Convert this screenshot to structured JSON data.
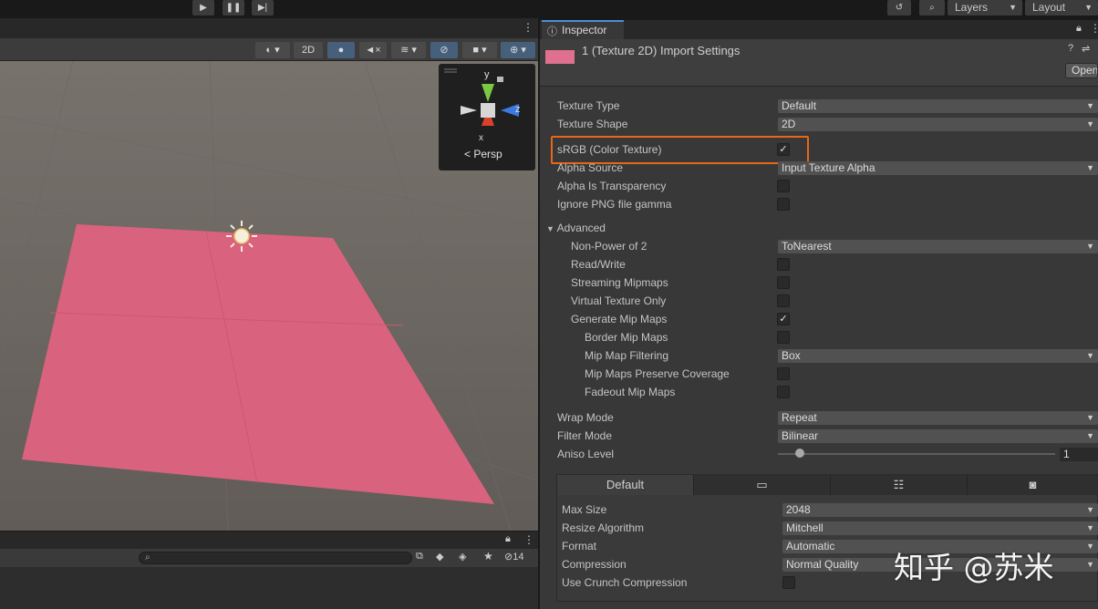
{
  "top_toolbar": {
    "play_icon": "play-icon",
    "pause_icon": "pause-icon",
    "step_icon": "step-icon",
    "history_icon": "history-icon",
    "search_icon": "search-icon",
    "layers_label": "Layers",
    "layout_label": "Layout"
  },
  "scene_toolbar": {
    "mode_2d": "2D",
    "gizmo_view": "< Persp",
    "axis_y": "y",
    "axis_z": "z",
    "axis_x": "x"
  },
  "bottom_panel": {
    "search_placeholder": "",
    "hidden_count": "14"
  },
  "inspector": {
    "tab_label": "Inspector",
    "header_title": "1 (Texture 2D) Import Settings",
    "open_button": "Open",
    "swatch_color": "#e07090",
    "rows": [
      {
        "label": "Texture Type",
        "value": "Default"
      },
      {
        "label": "Texture Shape",
        "value": "2D"
      },
      {
        "label": "sRGB (Color Texture)",
        "value": "✓"
      },
      {
        "label": "Alpha Source",
        "value": "Input Texture Alpha"
      },
      {
        "label": "Alpha Is Transparency",
        "value": ""
      },
      {
        "label": "Ignore PNG file gamma",
        "value": ""
      }
    ],
    "advanced": {
      "label": "Advanced",
      "rows": [
        {
          "label": "Non-Power of 2",
          "value": "ToNearest"
        },
        {
          "label": "Read/Write",
          "value": ""
        },
        {
          "label": "Streaming Mipmaps",
          "value": ""
        },
        {
          "label": "Virtual Texture Only",
          "value": ""
        },
        {
          "label": "Generate Mip Maps",
          "value": "✓"
        },
        {
          "label": "Border Mip Maps",
          "value": ""
        },
        {
          "label": "Mip Map Filtering",
          "value": "Box"
        },
        {
          "label": "Mip Maps Preserve Coverage",
          "value": ""
        },
        {
          "label": "Fadeout Mip Maps",
          "value": ""
        }
      ]
    },
    "wrap_rows": [
      {
        "label": "Wrap Mode",
        "value": "Repeat"
      },
      {
        "label": "Filter Mode",
        "value": "Bilinear"
      },
      {
        "label": "Aniso Level",
        "value": "1"
      }
    ],
    "platform": {
      "default_tab": "Default",
      "rows": [
        {
          "label": "Max Size",
          "value": "2048"
        },
        {
          "label": "Resize Algorithm",
          "value": "Mitchell"
        },
        {
          "label": "Format",
          "value": "Automatic"
        },
        {
          "label": "Compression",
          "value": "Normal Quality"
        },
        {
          "label": "Use Crunch Compression",
          "value": ""
        }
      ]
    }
  },
  "watermark": "知乎 @苏米",
  "colors": {
    "accent": "#4a8fd8",
    "highlight": "#e8661c",
    "plane": "#d9627f"
  }
}
